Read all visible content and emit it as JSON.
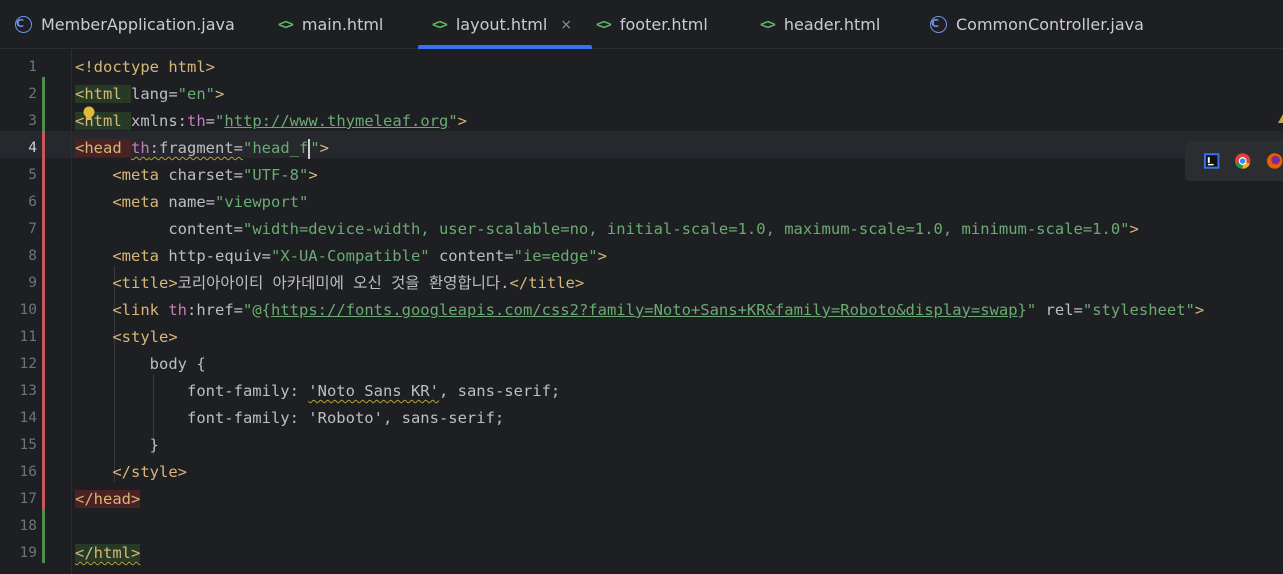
{
  "tabs": [
    {
      "label": "MemberApplication.java",
      "icon": "java-class-icon",
      "active": false
    },
    {
      "label": "main.html",
      "icon": "html-file-icon",
      "active": false
    },
    {
      "label": "layout.html",
      "icon": "html-file-icon",
      "active": true,
      "close": "×"
    },
    {
      "label": "footer.html",
      "icon": "html-file-icon",
      "active": false
    },
    {
      "label": "header.html",
      "icon": "html-file-icon",
      "active": false
    },
    {
      "label": "CommonController.java",
      "icon": "java-class-icon",
      "active": false
    }
  ],
  "java_icon_letter": "C",
  "html_icon_glyph": "<>",
  "editor": {
    "current_line": 4,
    "line_numbers": [
      "1",
      "2",
      "3",
      "4",
      "5",
      "6",
      "7",
      "8",
      "9",
      "10",
      "11",
      "12",
      "13",
      "14",
      "15",
      "16",
      "17",
      "18",
      "19"
    ],
    "lines": [
      {
        "segments": [
          [
            "tg",
            "<!doctype "
          ],
          [
            "tg",
            "html"
          ],
          [
            "tg",
            ">"
          ]
        ]
      },
      {
        "segments": [
          [
            "tg",
            "<html "
          ],
          [
            "at",
            "lang="
          ],
          [
            "st",
            "\"en\""
          ],
          [
            "tg",
            ">"
          ]
        ]
      },
      {
        "segments": [
          [
            "tg",
            "<html "
          ],
          [
            "at",
            "xmlns:"
          ],
          [
            "ns",
            "th"
          ],
          [
            "at",
            "="
          ],
          [
            "st",
            "\""
          ],
          [
            "ur",
            "http://www.thymeleaf.org"
          ],
          [
            "st",
            "\""
          ],
          [
            "tg",
            ">"
          ]
        ]
      },
      {
        "segments": [
          [
            "tg",
            "<head "
          ],
          [
            "ns",
            "th"
          ],
          [
            "at",
            ":fragment="
          ],
          [
            "st",
            "\"head_f"
          ],
          [
            "caret",
            ""
          ],
          [
            "st",
            "\""
          ],
          [
            "tg",
            ">"
          ]
        ]
      },
      {
        "segments": [
          [
            "tx",
            "    "
          ],
          [
            "tg",
            "<meta "
          ],
          [
            "at",
            "charset="
          ],
          [
            "st",
            "\"UTF-8\""
          ],
          [
            "tg",
            ">"
          ]
        ]
      },
      {
        "segments": [
          [
            "tx",
            "    "
          ],
          [
            "tg",
            "<meta "
          ],
          [
            "at",
            "name="
          ],
          [
            "st",
            "\"viewport\""
          ]
        ]
      },
      {
        "segments": [
          [
            "tx",
            "          "
          ],
          [
            "at",
            "content="
          ],
          [
            "st",
            "\"width=device-width, user-scalable=no, initial-scale=1.0, maximum-scale=1.0, minimum-scale=1.0\""
          ],
          [
            "tg",
            ">"
          ]
        ]
      },
      {
        "segments": [
          [
            "tx",
            "    "
          ],
          [
            "tg",
            "<meta "
          ],
          [
            "at",
            "http-equiv="
          ],
          [
            "st",
            "\"X-UA-Compatible\" "
          ],
          [
            "at",
            "content="
          ],
          [
            "st",
            "\"ie=edge\""
          ],
          [
            "tg",
            ">"
          ]
        ]
      },
      {
        "segments": [
          [
            "tx",
            "    "
          ],
          [
            "tg",
            "<title>"
          ],
          [
            "tx",
            "코리아아이티 아카데미에 오신 것을 환영합니다."
          ],
          [
            "tg",
            "</title>"
          ]
        ]
      },
      {
        "segments": [
          [
            "tx",
            "    "
          ],
          [
            "tg",
            "<link "
          ],
          [
            "ns",
            "th"
          ],
          [
            "at",
            ":href="
          ],
          [
            "st",
            "\"@{"
          ],
          [
            "ur",
            "https://fonts.googleapis.com/css2?family=Noto+Sans+KR&family=Roboto&display=swap"
          ],
          [
            "st",
            "}\" "
          ],
          [
            "at",
            "rel="
          ],
          [
            "st",
            "\"stylesheet\""
          ],
          [
            "tg",
            ">"
          ]
        ]
      },
      {
        "segments": [
          [
            "tx",
            "    "
          ],
          [
            "tg",
            "<style>"
          ]
        ]
      },
      {
        "segments": [
          [
            "tx",
            "        body {"
          ]
        ]
      },
      {
        "segments": [
          [
            "tx",
            "            font-family: "
          ],
          [
            "tx",
            "'Noto Sans KR'"
          ],
          [
            "tx",
            ", sans-serif;"
          ]
        ]
      },
      {
        "segments": [
          [
            "tx",
            "            font-family: 'Roboto', sans-serif;"
          ]
        ]
      },
      {
        "segments": [
          [
            "tx",
            "        }"
          ]
        ]
      },
      {
        "segments": [
          [
            "tx",
            "    "
          ],
          [
            "tg",
            "</style>"
          ]
        ]
      },
      {
        "segments": [
          [
            "tg",
            "</head>"
          ]
        ]
      },
      {
        "segments": [
          [
            "tx",
            ""
          ]
        ]
      },
      {
        "segments": [
          [
            "tg",
            "</html>"
          ]
        ]
      }
    ]
  },
  "browser_icons": [
    "intellij-icon",
    "chrome-icon",
    "firefox-icon"
  ]
}
